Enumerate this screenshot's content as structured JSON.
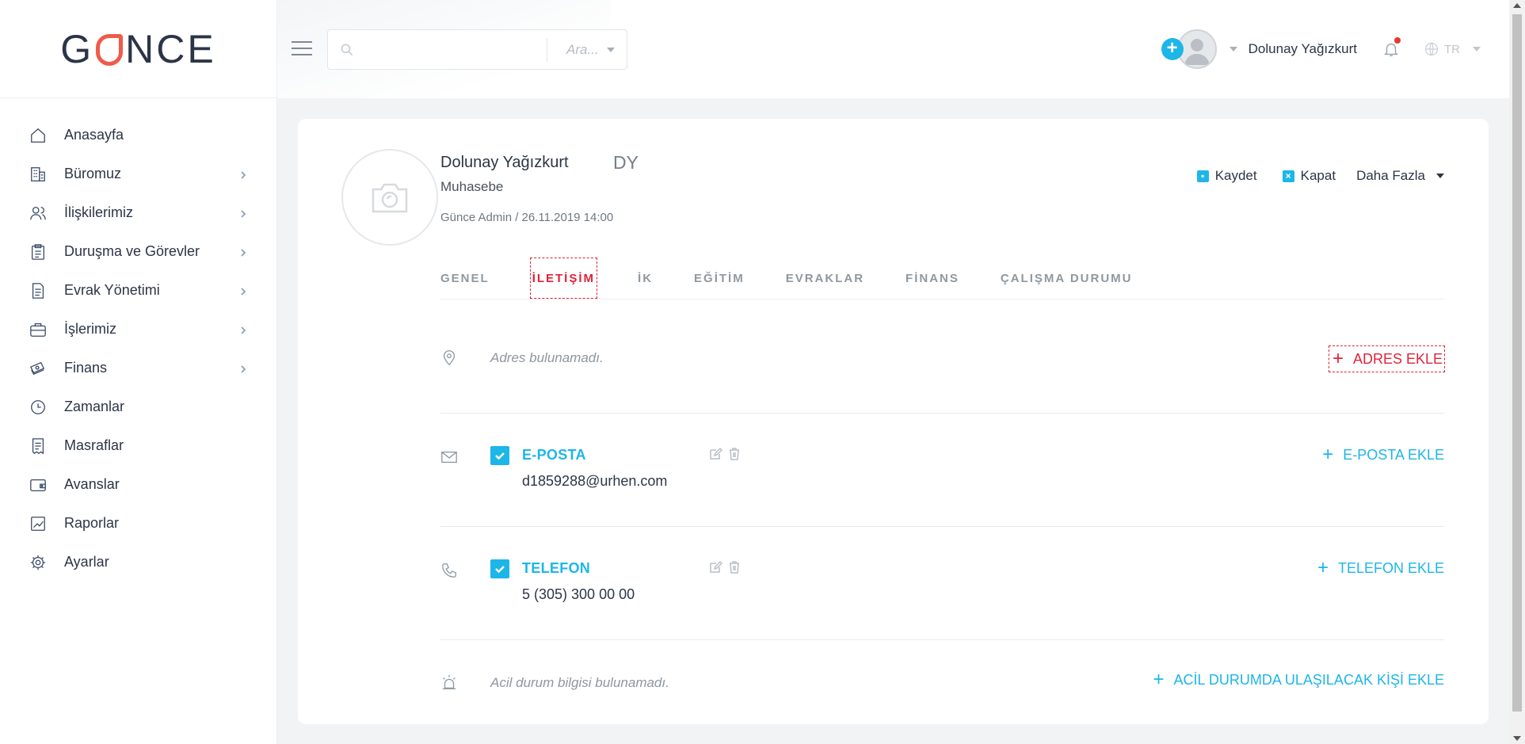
{
  "brand": {
    "logo_pre": "G",
    "logo_post": "NCE"
  },
  "sidebar": {
    "items": [
      {
        "label": "Anasayfa",
        "icon": "home-icon",
        "has_submenu": false
      },
      {
        "label": "Büromuz",
        "icon": "building-icon",
        "has_submenu": true
      },
      {
        "label": "İlişkilerimiz",
        "icon": "users-icon",
        "has_submenu": true
      },
      {
        "label": "Duruşma ve Görevler",
        "icon": "clipboard-icon",
        "has_submenu": true
      },
      {
        "label": "Evrak Yönetimi",
        "icon": "document-icon",
        "has_submenu": true
      },
      {
        "label": "İşlerimiz",
        "icon": "briefcase-icon",
        "has_submenu": true
      },
      {
        "label": "Finans",
        "icon": "money-icon",
        "has_submenu": true
      },
      {
        "label": "Zamanlar",
        "icon": "clock-icon",
        "has_submenu": false
      },
      {
        "label": "Masraflar",
        "icon": "receipt-icon",
        "has_submenu": false
      },
      {
        "label": "Avanslar",
        "icon": "wallet-icon",
        "has_submenu": false
      },
      {
        "label": "Raporlar",
        "icon": "chart-icon",
        "has_submenu": false
      },
      {
        "label": "Ayarlar",
        "icon": "gear-icon",
        "has_submenu": false
      }
    ]
  },
  "topbar": {
    "search_placeholder": "",
    "search_filter": "Ara...",
    "user_name": "Dolunay Yağızkurt",
    "language": "TR",
    "add_label": "+"
  },
  "profile": {
    "name": "Dolunay Yağızkurt",
    "initials": "DY",
    "role": "Muhasebe",
    "meta": "Günce Admin / 26.11.2019 14:00"
  },
  "actions": {
    "save": "Kaydet",
    "close": "Kapat",
    "more": "Daha Fazla"
  },
  "tabs": [
    {
      "label": "GENEL",
      "active": false
    },
    {
      "label": "İLETİŞİM",
      "active": true
    },
    {
      "label": "İK",
      "active": false
    },
    {
      "label": "EĞİTİM",
      "active": false
    },
    {
      "label": "EVRAKLAR",
      "active": false
    },
    {
      "label": "FİNANS",
      "active": false
    },
    {
      "label": "ÇALIŞMA DURUMU",
      "active": false
    }
  ],
  "contact": {
    "address": {
      "empty_text": "Adres bulunamadı.",
      "add_label": "ADRES EKLE"
    },
    "email": {
      "label": "E-POSTA",
      "value": "d1859288@urhen.com",
      "checked": true,
      "add_label": "E-POSTA EKLE"
    },
    "phone": {
      "label": "TELEFON",
      "value": "5 (305) 300 00 00",
      "checked": true,
      "add_label": "TELEFON EKLE"
    },
    "emergency": {
      "empty_text": "Acil durum bilgisi bulunamadı.",
      "add_label": "ACİL DURUMDA ULAŞILACAK KİŞİ EKLE"
    }
  },
  "colors": {
    "accent": "#1db6e8",
    "danger": "#e0233a",
    "logo_accent": "#ef5a4a",
    "text": "#2c3547"
  }
}
